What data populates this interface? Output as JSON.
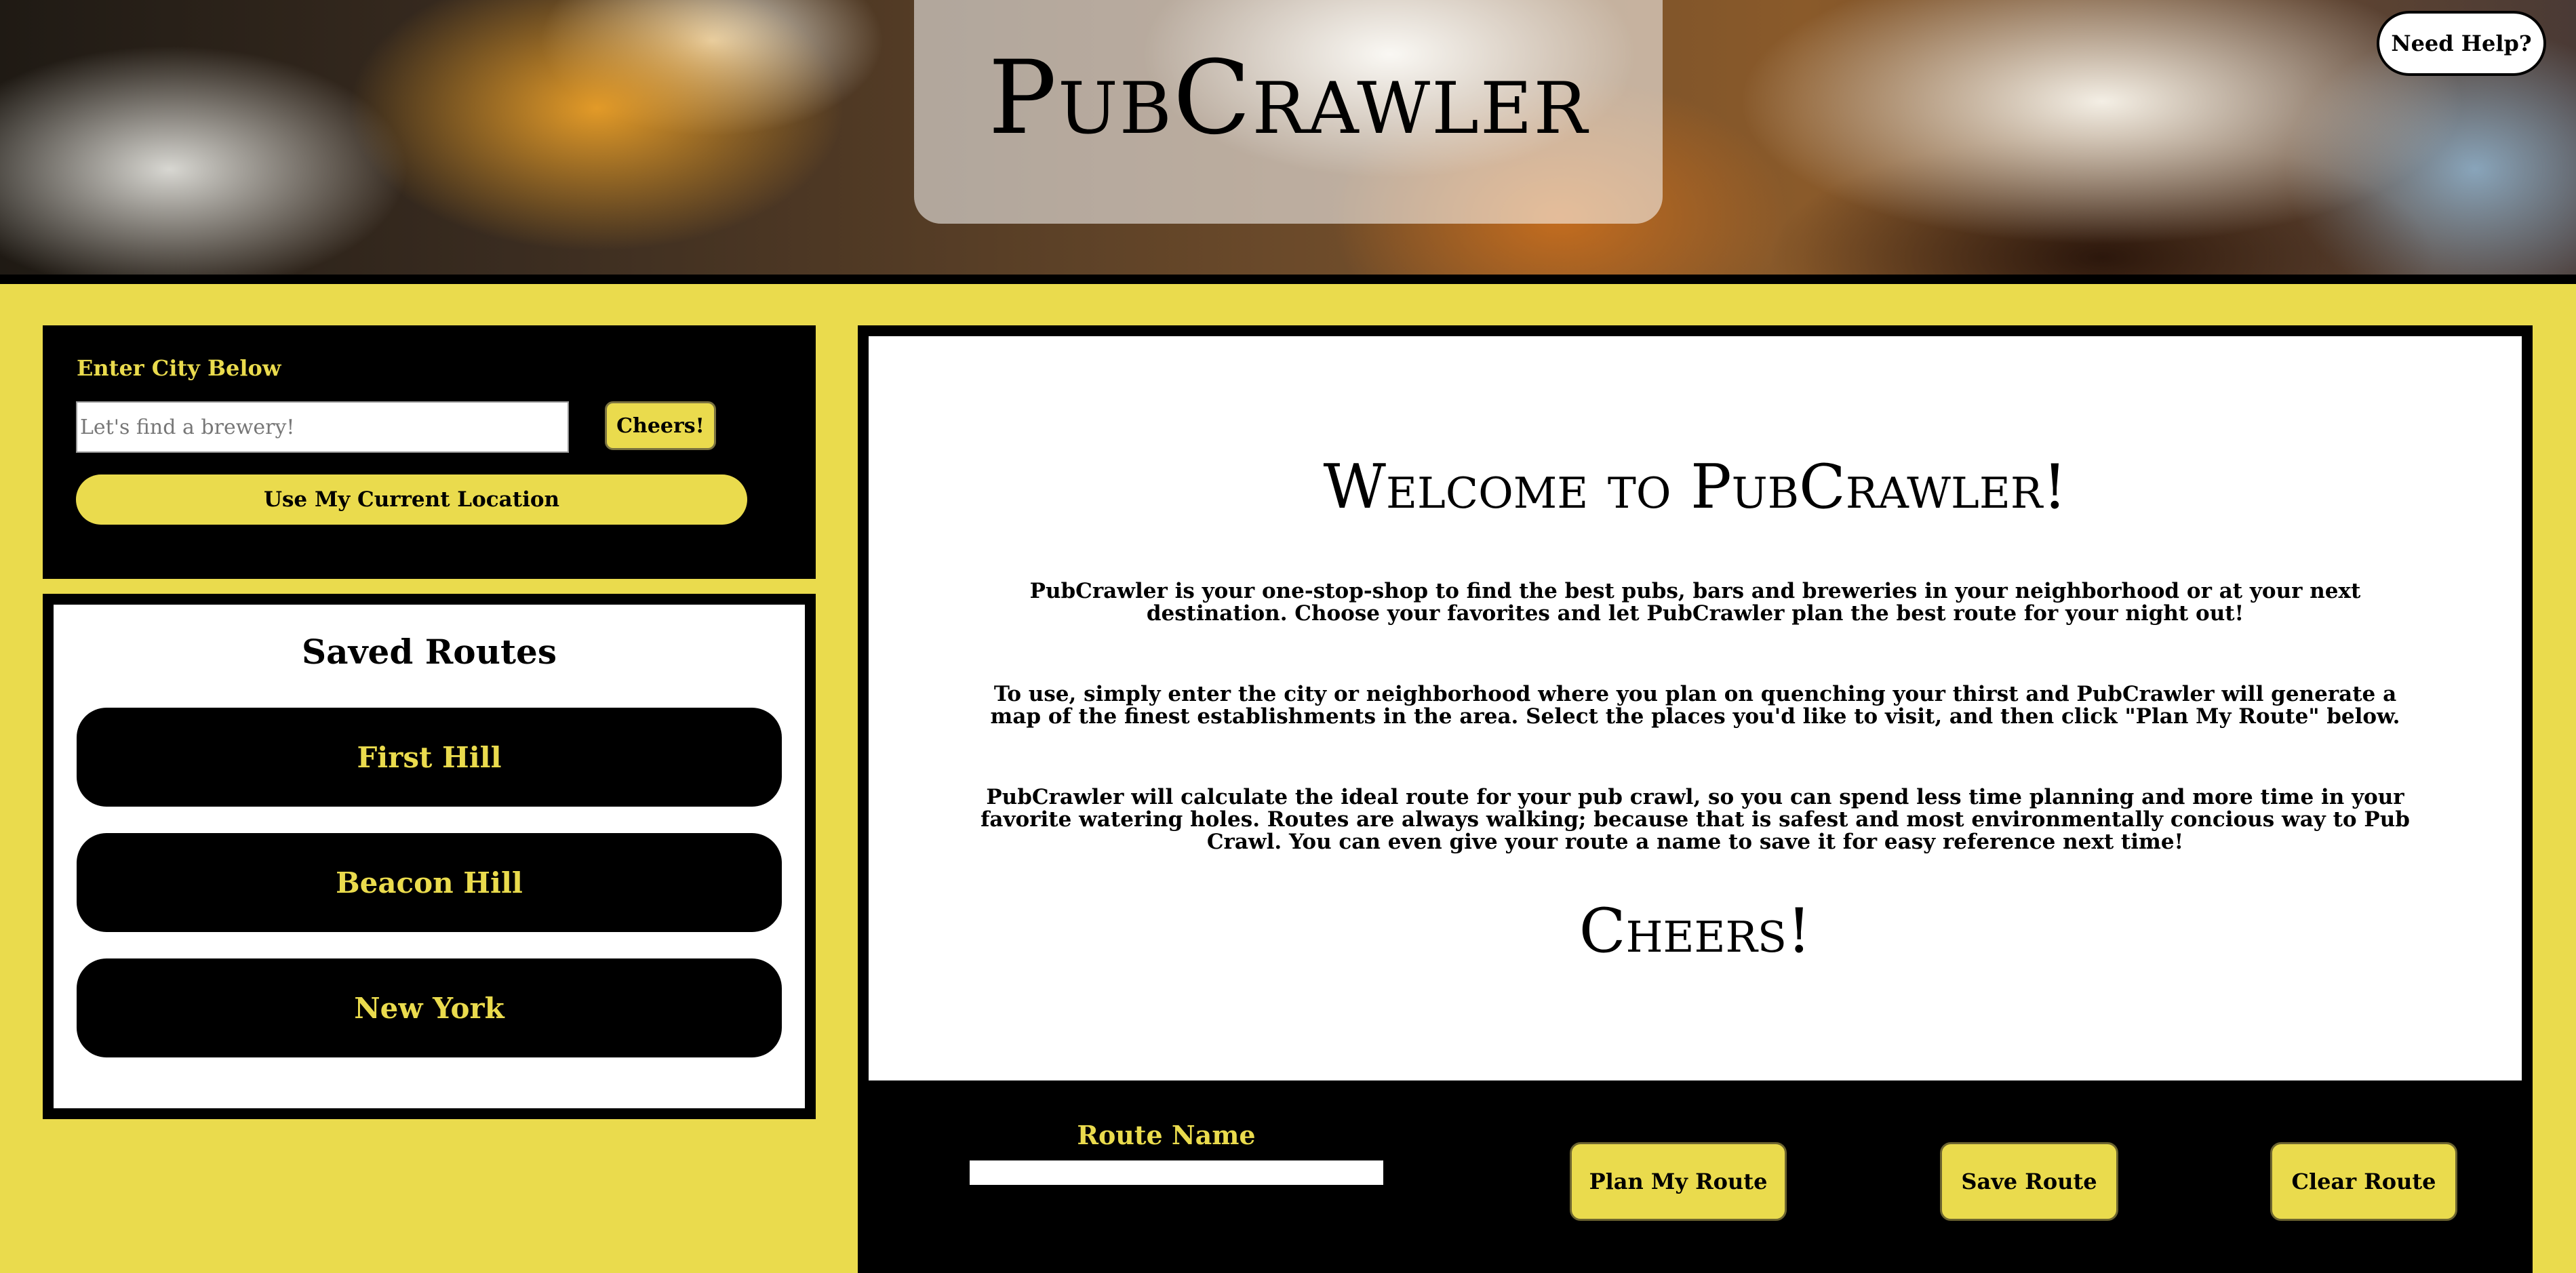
{
  "header": {
    "title": "PubCrawler",
    "help_label": "Need Help?"
  },
  "search": {
    "label": "Enter City Below",
    "placeholder": "Let's find a brewery!",
    "value": "",
    "submit_label": "Cheers!",
    "location_label": "Use My Current Location"
  },
  "saved_routes": {
    "title": "Saved Routes",
    "items": [
      {
        "label": "First Hill"
      },
      {
        "label": "Beacon Hill"
      },
      {
        "label": "New York"
      }
    ]
  },
  "welcome": {
    "heading": "Welcome to PubCrawler!",
    "paragraphs": [
      "PubCrawler is your one-stop-shop to find the best pubs, bars and breweries in your neighborhood or at your next destination. Choose your favorites and let PubCrawler plan the best route for your night out!",
      "To use, simply enter the city or neighborhood where you plan on quenching your thirst and PubCrawler will generate a map of the finest establishments in the area. Select the places you'd like to visit, and then click \"Plan My Route\" below.",
      "PubCrawler will calculate the ideal route for your pub crawl, so you can spend less time planning and more time in your favorite watering holes. Routes are always walking; because that is safest and most environmentally concious way to Pub Crawl. You can even give your route a name to save it for easy reference next time!"
    ],
    "closing": "Cheers!"
  },
  "route_controls": {
    "name_label": "Route Name",
    "name_value": "",
    "plan_label": "Plan My Route",
    "save_label": "Save Route",
    "clear_label": "Clear Route"
  },
  "colors": {
    "accent": "#eadb4d",
    "panel": "#000000",
    "surface": "#ffffff"
  }
}
